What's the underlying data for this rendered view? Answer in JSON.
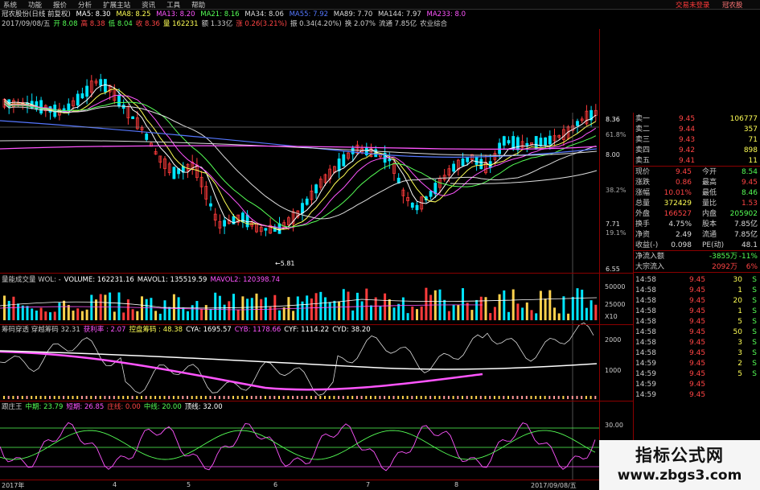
{
  "menu": {
    "items": [
      "系统",
      "功能",
      "报价",
      "分析",
      "扩展主站",
      "资讯",
      "工具",
      "帮助"
    ],
    "login_text": "交易未登录",
    "stock_short": "冠农股"
  },
  "header": {
    "title": "冠农股份(日线 前复权)",
    "ma": [
      {
        "label": "MA5: 8.30",
        "color": "#ffffff"
      },
      {
        "label": "MA8: 8.25",
        "color": "#ffff55"
      },
      {
        "label": "MA13: 8.20",
        "color": "#ff55ff"
      },
      {
        "label": "MA21: 8.16",
        "color": "#55ff55"
      },
      {
        "label": "MA34: 8.06",
        "color": "#dddddd"
      },
      {
        "label": "MA55: 7.92",
        "color": "#5577ff"
      },
      {
        "label": "MA89: 7.70",
        "color": "#dddddd"
      },
      {
        "label": "MA144: 7.97",
        "color": "#dddddd"
      },
      {
        "label": "MA233: 8.0",
        "color": "#ff55ff"
      }
    ]
  },
  "quote_line": [
    {
      "label": "2017/09/08/五",
      "color": "#cccccc"
    },
    {
      "label": "开 8.08",
      "color": "#55ff55"
    },
    {
      "label": "高 8.38",
      "color": "#ff4444"
    },
    {
      "label": "低 8.04",
      "color": "#55ff55"
    },
    {
      "label": "收 8.36",
      "color": "#ff4444"
    },
    {
      "label": "量 162231",
      "color": "#ffff55"
    },
    {
      "label": "额 1.33亿",
      "color": "#cccccc"
    },
    {
      "label": "涨 0.26(3.21%)",
      "color": "#ff4444"
    },
    {
      "label": "振 0.34(4.20%)",
      "color": "#cccccc"
    },
    {
      "label": "换 2.07%",
      "color": "#cccccc"
    },
    {
      "label": "流通 7.85亿",
      "color": "#cccccc"
    },
    {
      "label": "农业综合",
      "color": "#cccccc"
    }
  ],
  "price_axis": [
    {
      "label": "8.36",
      "color": "#ffffff"
    },
    {
      "label": "61.8%",
      "color": "#aaaaaa"
    },
    {
      "label": "8.00",
      "color": "#dddddd"
    },
    {
      "label": "38.2%",
      "color": "#aaaaaa"
    },
    {
      "label": "7.71",
      "color": "#dddddd"
    },
    {
      "label": "19.1%",
      "color": "#aaaaaa"
    },
    {
      "label": "6.55",
      "color": "#dddddd"
    }
  ],
  "low_marker": "←5.81",
  "volume_header": [
    {
      "label": "量能成交量 WOL: -",
      "color": "#cccccc"
    },
    {
      "label": "VOLUME: 162231.16",
      "color": "#ffffff"
    },
    {
      "label": "MAVOL1: 135519.59",
      "color": "#ffffff"
    },
    {
      "label": "MAVOL2: 120398.74",
      "color": "#ff55ff"
    }
  ],
  "volume_axis": [
    "50000",
    "25000",
    "X10"
  ],
  "chip_header": [
    {
      "label": "筹码穿透 穿越筹码 32.31",
      "color": "#cccccc"
    },
    {
      "label": "获利率 : 2.07",
      "color": "#ff55ff"
    },
    {
      "label": "控盘筹码 : 48.38",
      "color": "#ffff55"
    },
    {
      "label": "CYA: 1695.57",
      "color": "#ffffff"
    },
    {
      "label": "CYB: 1178.66",
      "color": "#ff55ff"
    },
    {
      "label": "CYF: 1114.22",
      "color": "#ffffff"
    },
    {
      "label": "CYD: 38.20",
      "color": "#ffffff"
    }
  ],
  "chip_axis": [
    "2000",
    "1000"
  ],
  "osc_header": [
    {
      "label": "跟庄王",
      "color": "#cccccc"
    },
    {
      "label": "中期: 23.79",
      "color": "#55ff55"
    },
    {
      "label": "短期: 26.85",
      "color": "#ff55ff"
    },
    {
      "label": "庄线: 0.00",
      "color": "#ff4444"
    },
    {
      "label": "中线: 20.00",
      "color": "#55ff55"
    },
    {
      "label": "顶线: 32.00",
      "color": "#ffffff"
    }
  ],
  "osc_axis": [
    "30.00",
    "20.00"
  ],
  "date_axis": [
    "2017年",
    "4",
    "5",
    "6",
    "7",
    "8",
    "2017/09/08/五"
  ],
  "orderbook": {
    "asks": [
      {
        "label": "卖一",
        "price": "9.45",
        "vol": "106777"
      },
      {
        "label": "卖二",
        "price": "9.44",
        "vol": "357"
      },
      {
        "label": "卖三",
        "price": "9.43",
        "vol": "71"
      },
      {
        "label": "卖四",
        "price": "9.42",
        "vol": "898"
      },
      {
        "label": "卖五",
        "price": "9.41",
        "vol": "11"
      }
    ],
    "stats": [
      {
        "k1": "现价",
        "v1": "9.45",
        "k2": "今开",
        "v2": "8.54",
        "c1": "#ff4444",
        "c2": "#55ff55"
      },
      {
        "k1": "涨跌",
        "v1": "0.86",
        "k2": "最高",
        "v2": "9.45",
        "c1": "#ff4444",
        "c2": "#ff4444"
      },
      {
        "k1": "涨幅",
        "v1": "10.01%",
        "k2": "最低",
        "v2": "8.46",
        "c1": "#ff4444",
        "c2": "#55ff55"
      },
      {
        "k1": "总量",
        "v1": "372429",
        "k2": "量比",
        "v2": "1.53",
        "c1": "#ffff55",
        "c2": "#ff4444"
      },
      {
        "k1": "外盘",
        "v1": "166527",
        "k2": "内盘",
        "v2": "205902",
        "c1": "#ff4444",
        "c2": "#55ff55"
      },
      {
        "k1": "换手",
        "v1": "4.75%",
        "k2": "股本",
        "v2": "7.85亿",
        "c1": "#dddddd",
        "c2": "#dddddd"
      },
      {
        "k1": "净资",
        "v1": "2.49",
        "k2": "流通",
        "v2": "7.85亿",
        "c1": "#dddddd",
        "c2": "#dddddd"
      },
      {
        "k1": "收益(-)",
        "v1": "0.098",
        "k2": "PE(动)",
        "v2": "48.1",
        "c1": "#dddddd",
        "c2": "#dddddd"
      }
    ],
    "flows": [
      {
        "label": "净流入额",
        "value": "-3855万",
        "pct": "-11%",
        "c": "#55ff55"
      },
      {
        "label": "大宗流入",
        "value": "2092万",
        "pct": "6%",
        "c": "#ff4444"
      }
    ],
    "ticks": [
      {
        "time": "14:58",
        "price": "9.45",
        "vol": "30",
        "dir": "S"
      },
      {
        "time": "14:58",
        "price": "9.45",
        "vol": "1",
        "dir": "S"
      },
      {
        "time": "14:58",
        "price": "9.45",
        "vol": "20",
        "dir": "S"
      },
      {
        "time": "14:58",
        "price": "9.45",
        "vol": "1",
        "dir": "S"
      },
      {
        "time": "14:58",
        "price": "9.45",
        "vol": "5",
        "dir": "S"
      },
      {
        "time": "14:58",
        "price": "9.45",
        "vol": "50",
        "dir": "S"
      },
      {
        "time": "14:58",
        "price": "9.45",
        "vol": "3",
        "dir": "S"
      },
      {
        "time": "14:58",
        "price": "9.45",
        "vol": "3",
        "dir": "S"
      },
      {
        "time": "14:59",
        "price": "9.45",
        "vol": "2",
        "dir": "S"
      },
      {
        "time": "14:59",
        "price": "9.45",
        "vol": "5",
        "dir": "S"
      },
      {
        "time": "14:59",
        "price": "9.45",
        "vol": "",
        "dir": ""
      },
      {
        "time": "14:59",
        "price": "9.45",
        "vol": "",
        "dir": ""
      }
    ]
  },
  "watermark": {
    "title": "指标公式网",
    "url": "www.zbgs3.com"
  },
  "colors": {
    "up": "#ff3b3b",
    "down": "#00e5ff",
    "border": "#8b0000"
  }
}
